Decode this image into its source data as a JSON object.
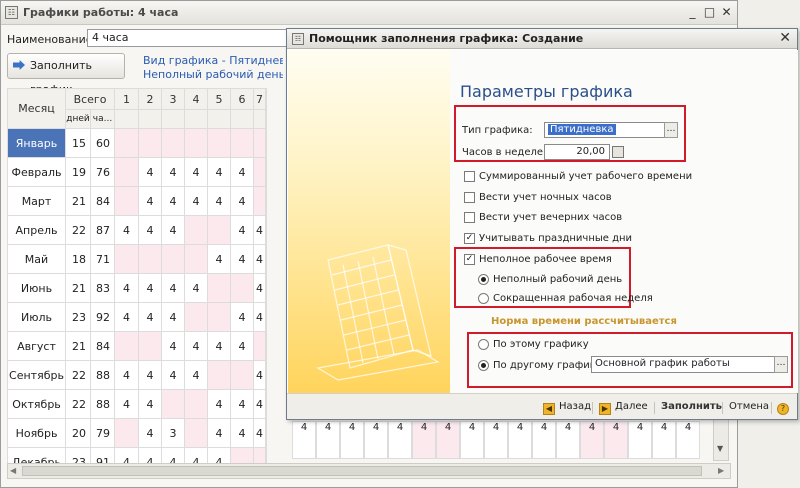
{
  "main": {
    "title": "Графики работы: 4 часа",
    "name_label": "Наименование:",
    "name_value": "4 часа",
    "fill_button": "Заполнить график",
    "desc_line1": "Вид графика - Пятидневка, Сок",
    "desc_line2": "Неполный рабочий день, Графи",
    "headers": {
      "month": "Месяц",
      "total": "Всего",
      "days": "дней",
      "hours": "ча..."
    },
    "day_cols": [
      "1",
      "2",
      "3",
      "4",
      "5",
      "6",
      "7"
    ],
    "rows": [
      {
        "month": "Январь",
        "days": "15",
        "hours": "60",
        "cells": [
          "",
          "",
          "",
          "",
          "",
          "",
          ""
        ]
      },
      {
        "month": "Февраль",
        "days": "19",
        "hours": "76",
        "cells": [
          "",
          "4",
          "4",
          "4",
          "4",
          "4",
          ""
        ]
      },
      {
        "month": "Март",
        "days": "21",
        "hours": "84",
        "cells": [
          "",
          "4",
          "4",
          "4",
          "4",
          "4",
          ""
        ]
      },
      {
        "month": "Апрель",
        "days": "22",
        "hours": "87",
        "cells": [
          "4",
          "4",
          "4",
          "",
          "",
          "4",
          "4"
        ]
      },
      {
        "month": "Май",
        "days": "18",
        "hours": "71",
        "cells": [
          "",
          "",
          "",
          "",
          "4",
          "4",
          "4"
        ]
      },
      {
        "month": "Июнь",
        "days": "21",
        "hours": "83",
        "cells": [
          "4",
          "4",
          "4",
          "4",
          "",
          "",
          "4"
        ]
      },
      {
        "month": "Июль",
        "days": "23",
        "hours": "92",
        "cells": [
          "4",
          "4",
          "4",
          "",
          "",
          "4",
          "4"
        ]
      },
      {
        "month": "Август",
        "days": "21",
        "hours": "84",
        "cells": [
          "",
          "",
          "4",
          "4",
          "4",
          "4",
          ""
        ]
      },
      {
        "month": "Сентябрь",
        "days": "22",
        "hours": "88",
        "cells": [
          "4",
          "4",
          "4",
          "4",
          "",
          "",
          "4"
        ]
      },
      {
        "month": "Октябрь",
        "days": "22",
        "hours": "88",
        "cells": [
          "4",
          "4",
          "",
          "",
          "4",
          "4",
          "4"
        ]
      },
      {
        "month": "Ноябрь",
        "days": "20",
        "hours": "79",
        "cells": [
          "",
          "4",
          "3",
          "",
          "4",
          "4",
          "4"
        ]
      },
      {
        "month": "Декабрь",
        "days": "23",
        "hours": "91",
        "cells": [
          "4",
          "4",
          "4",
          "4",
          "4",
          "",
          ""
        ]
      }
    ],
    "bottom_strip": [
      "4",
      "4",
      "4",
      "4",
      "4",
      "4",
      "4",
      "4",
      "4",
      "4",
      "4",
      "4",
      "4",
      "4",
      "4",
      "4",
      "4"
    ]
  },
  "wizard": {
    "title": "Помощник заполнения графика: Создание",
    "heading": "Параметры графика",
    "schedule_type_label": "Тип графика:",
    "schedule_type_value": "Пятидневка",
    "hours_week_label": "Часов в неделе:",
    "hours_week_value": "20,00",
    "checkboxes": [
      {
        "label": "Суммированный учет рабочего времени",
        "checked": false
      },
      {
        "label": "Вести учет ночных часов",
        "checked": false
      },
      {
        "label": "Вести учет вечерних часов",
        "checked": false
      },
      {
        "label": "Учитывать праздничные дни",
        "checked": true
      }
    ],
    "part_time_label": "Неполное рабочее время",
    "part_time_checked": true,
    "radio_day": "Неполный рабочий день",
    "radio_week": "Сокращенная рабочая неделя",
    "norm_section": "Норма времени рассчитывается",
    "radio_this": "По этому графику",
    "radio_other": "По другому графику:",
    "other_schedule_value": "Основной график работы",
    "back": "Назад",
    "next": "Далее",
    "fill": "Заполнить",
    "cancel": "Отмена",
    "help": "?"
  },
  "colors": {
    "accent": "#2a4f8a",
    "highlight": "#d21b2a",
    "selection": "#4a73b8",
    "weekend": "#fbe9ee"
  }
}
